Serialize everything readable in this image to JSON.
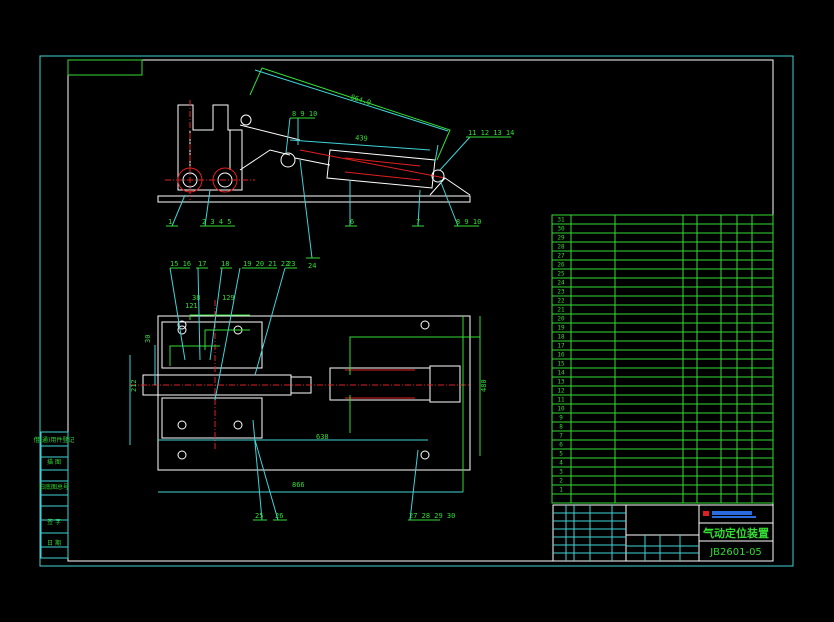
{
  "drawing": {
    "title": "气动定位装置",
    "drawing_number": "JB2601-05",
    "colors": {
      "background": "#000000",
      "frame": "#3fd3d8",
      "border": "#ffffff",
      "dimension": "#33dd33",
      "centerline": "#e02020"
    }
  },
  "side_view": {
    "dimensions": {
      "overall": "864.9",
      "stroke": "439"
    },
    "balloons": [
      "1",
      "2 3 4 5",
      "6",
      "7",
      "8 9 10",
      "8 9 10",
      "11 12 13 14",
      "24"
    ]
  },
  "plan_view": {
    "dimensions": {
      "d1": "38",
      "d2": "121",
      "d3": "129",
      "d4": "30",
      "d5": "212",
      "d6": "638",
      "d7": "866",
      "d8": "480"
    },
    "balloons": [
      "15 16",
      "17",
      "18",
      "19 20 21 22",
      "23",
      "25",
      "26",
      "27 28 29 30"
    ]
  },
  "left_strip": [
    "借(通)用件登记",
    "描 图",
    "旧底图总号",
    "签 字",
    "日 期"
  ],
  "parts_list": {
    "row_numbers": [
      "31",
      "30",
      "29",
      "28",
      "27",
      "26",
      "25",
      "24",
      "23",
      "22",
      "21",
      "20",
      "19",
      "18",
      "17",
      "16",
      "15",
      "14",
      "13",
      "12",
      "11",
      "10",
      "9",
      "8",
      "7",
      "6",
      "5",
      "4",
      "3",
      "2",
      "1"
    ]
  }
}
